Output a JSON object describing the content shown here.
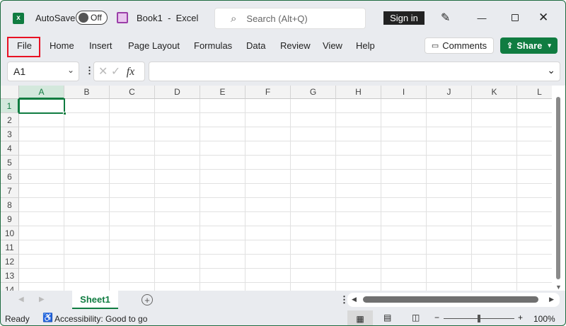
{
  "title": {
    "autosave_label": "AutoSave",
    "autosave_state": "Off",
    "doc_title": "Book1  -  Excel",
    "search_placeholder": "Search (Alt+Q)",
    "sign_in": "Sign in"
  },
  "ribbon": {
    "tabs": [
      "File",
      "Home",
      "Insert",
      "Page Layout",
      "Formulas",
      "Data",
      "Review",
      "View",
      "Help"
    ],
    "comments": "Comments",
    "share": "Share"
  },
  "formula_bar": {
    "name_box": "A1",
    "fx": "fx",
    "formula": ""
  },
  "grid": {
    "columns": [
      "A",
      "B",
      "C",
      "D",
      "E",
      "F",
      "G",
      "H",
      "I",
      "J",
      "K",
      "L"
    ],
    "rows": [
      "1",
      "2",
      "3",
      "4",
      "5",
      "6",
      "7",
      "8",
      "9",
      "10",
      "11",
      "12",
      "13",
      "14"
    ],
    "selected_cell": "A1"
  },
  "sheets": {
    "tabs": [
      "Sheet1"
    ],
    "active": "Sheet1"
  },
  "status": {
    "ready": "Ready",
    "accessibility": "Accessibility: Good to go",
    "zoom": "100%",
    "zoom_level_percent": 100
  },
  "colors": {
    "accent": "#107c41",
    "highlight": "#e81123"
  }
}
